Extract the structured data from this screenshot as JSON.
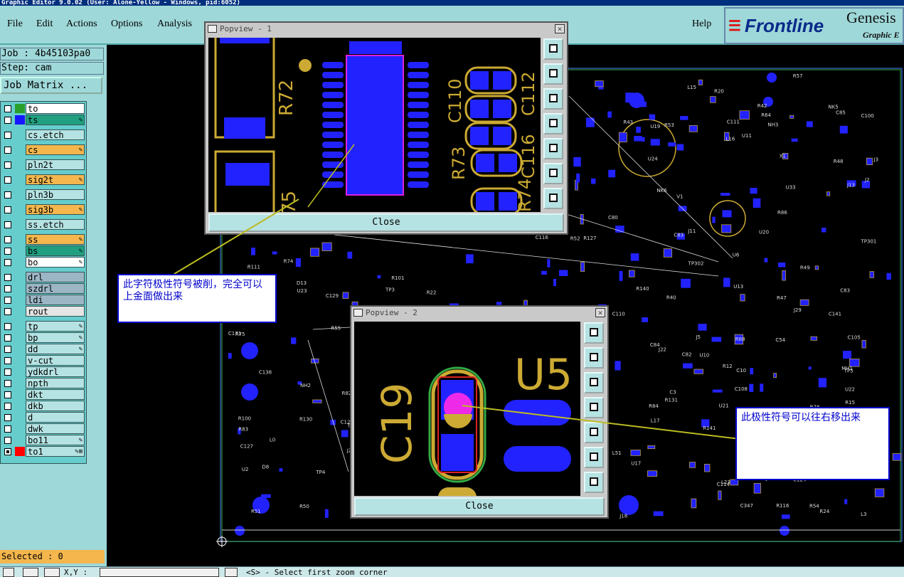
{
  "window": {
    "title": "Graphic Editor 9.0.02 (User: Alone-Yellow - Windows, pid:6052)"
  },
  "menu": {
    "file": "File",
    "edit": "Edit",
    "actions": "Actions",
    "options": "Options",
    "analysis": "Analysis",
    "help": "Help"
  },
  "logo": {
    "brand": "Frontline",
    "product": "Genesis",
    "subtitle": "Graphic E"
  },
  "job": {
    "job_label": "Job : 4b45103pa0",
    "step_label": "Step: cam",
    "matrix_button": "Job Matrix ..."
  },
  "layers": [
    {
      "name": "to",
      "color": "#2aa02a",
      "bg": "#ffffff",
      "icon": ""
    },
    {
      "name": "ts",
      "color": "#1515ff",
      "bg": "#20a080",
      "icon": "✎"
    },
    {
      "name": "cs.etch",
      "color": "",
      "bg": "#b5e2e2",
      "icon": ""
    },
    {
      "name": "cs",
      "color": "",
      "bg": "#f4b64d",
      "icon": "✎"
    },
    {
      "name": "pln2t",
      "color": "",
      "bg": "#b5e2e2",
      "icon": ""
    },
    {
      "name": "sig2t",
      "color": "",
      "bg": "#f4b64d",
      "icon": "✎"
    },
    {
      "name": "pln3b",
      "color": "",
      "bg": "#b5e2e2",
      "icon": ""
    },
    {
      "name": "sig3b",
      "color": "",
      "bg": "#f4b64d",
      "icon": "✎"
    },
    {
      "name": "ss.etch",
      "color": "",
      "bg": "#b5e2e2",
      "icon": ""
    },
    {
      "name": "ss",
      "color": "",
      "bg": "#f4b64d",
      "icon": "✎"
    },
    {
      "name": "bs",
      "color": "",
      "bg": "#20a080",
      "icon": "✎"
    },
    {
      "name": "bo",
      "color": "",
      "bg": "#ffffff",
      "icon": "✎"
    },
    {
      "name": "drl",
      "color": "",
      "bg": "#9cb6c5",
      "icon": ""
    },
    {
      "name": "szdrl",
      "color": "",
      "bg": "#9cb6c5",
      "icon": ""
    },
    {
      "name": "ldi",
      "color": "",
      "bg": "#9cb6c5",
      "icon": ""
    },
    {
      "name": "rout",
      "color": "",
      "bg": "#e5e5e5",
      "icon": ""
    },
    {
      "name": "tp",
      "color": "",
      "bg": "#b5e2e2",
      "icon": "✎"
    },
    {
      "name": "bp",
      "color": "",
      "bg": "#b5e2e2",
      "icon": "✎"
    },
    {
      "name": "dd",
      "color": "",
      "bg": "#b5e2e2",
      "icon": "✎"
    },
    {
      "name": "v-cut",
      "color": "",
      "bg": "#b5e2e2",
      "icon": ""
    },
    {
      "name": "ydkdrl",
      "color": "",
      "bg": "#b5e2e2",
      "icon": ""
    },
    {
      "name": "npth",
      "color": "",
      "bg": "#b5e2e2",
      "icon": ""
    },
    {
      "name": "dkt",
      "color": "",
      "bg": "#b5e2e2",
      "icon": ""
    },
    {
      "name": "dkb",
      "color": "",
      "bg": "#b5e2e2",
      "icon": ""
    },
    {
      "name": "d",
      "color": "",
      "bg": "#b5e2e2",
      "icon": ""
    },
    {
      "name": "dwk",
      "color": "",
      "bg": "#b5e2e2",
      "icon": ""
    },
    {
      "name": "bo11",
      "color": "",
      "bg": "#b5e2e2",
      "icon": "✎"
    },
    {
      "name": "to1",
      "color": "#ff0000",
      "bg": "#b5e2e2",
      "icon": "✎⊞"
    }
  ],
  "status": {
    "selected": "Selected : 0",
    "coords_label": "X,Y :",
    "prompt": "<S> - Select first zoom corner"
  },
  "popup1": {
    "title": "Popview - 1",
    "close": "Close",
    "labels": [
      "R72",
      "R73",
      "C110",
      "C112",
      "C116",
      "R74",
      "75"
    ]
  },
  "popup2": {
    "title": "Popview - 2",
    "close": "Close",
    "labels": [
      "U5",
      "C19"
    ]
  },
  "notes": {
    "note1": "此字符极性符号被削，完全可以上金面做出来",
    "note2": "此极性符号可以往右移出来"
  },
  "board_labels": [
    "C136",
    "MH1",
    "U24",
    "J2",
    "NK5",
    "U2",
    "C138",
    "C141",
    "U33",
    "J18",
    "L51",
    "J13",
    "C111",
    "R79",
    "J11",
    "R78",
    "C114",
    "C100",
    "U21",
    "C110",
    "C116",
    "R74",
    "R75",
    "J19",
    "R42",
    "R43",
    "L0",
    "V1",
    "J14",
    "U23",
    "R24",
    "C124",
    "L16",
    "U10",
    "R131",
    "R130",
    "U11",
    "U6",
    "R127",
    "R47",
    "TP4",
    "TP3",
    "C54",
    "J5",
    "J21",
    "J29",
    "C105",
    "C108",
    "R116",
    "U13",
    "D8",
    "R40",
    "TP6",
    "TP5",
    "TP8",
    "C83",
    "D13",
    "C347",
    "R140",
    "R141",
    "R100",
    "R101",
    "L17",
    "C85",
    "U20",
    "R84",
    "R82",
    "R83",
    "R20",
    "U19",
    "J22",
    "R12",
    "R15",
    "J3",
    "NK6",
    "NH2",
    "NH3",
    "U17",
    "R86",
    "R88",
    "C80",
    "R48",
    "R49",
    "R51",
    "R52",
    "C84",
    "R53",
    "R54",
    "R55",
    "L3",
    "L23",
    "L15",
    "C10",
    "R50",
    "R57",
    "X1",
    "C120",
    "C171",
    "C129",
    "U22",
    "R22",
    "C3",
    "C127",
    "C82",
    "C83",
    "TP301",
    "TP302",
    "R111",
    "C76",
    "R64"
  ]
}
